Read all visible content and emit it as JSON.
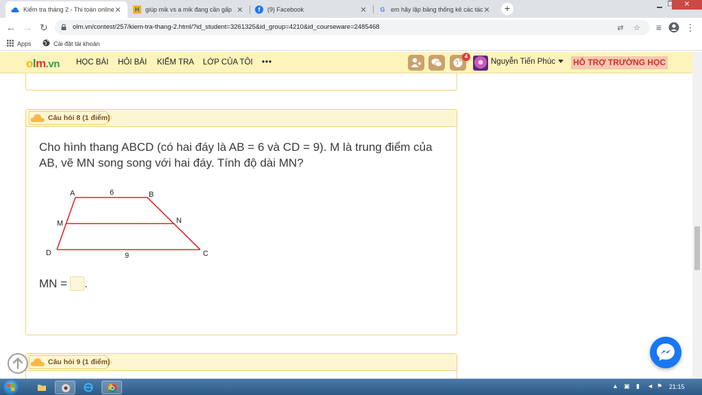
{
  "browser": {
    "tabs": [
      {
        "title": "Kiểm tra tháng 2 - Thi toán online",
        "icon": "cloud-icon"
      },
      {
        "title": "giúp mik vs a mik đang cần gấp",
        "icon": "hoc24-icon"
      },
      {
        "title": "(9) Facebook",
        "icon": "facebook-icon"
      },
      {
        "title": "em hãy lập bảng thống kê các tác",
        "icon": "google-icon"
      }
    ],
    "new_tab": "+",
    "url": "olm.vn/contest/257/kiem-tra-thang-2.html/?id_student=3261325&id_group=4210&id_courseware=2485468",
    "bookmarks": {
      "apps": "Apps",
      "account": "Cài đặt tài khoản"
    }
  },
  "site": {
    "logo": {
      "o": "o",
      "l": "l",
      "m": "m",
      "dv": ".vn"
    },
    "nav": {
      "hoc_bai": "HỌC BÀI",
      "hoi_bai": "HỎI BÀI",
      "kiem_tra": "KIỂM TRA",
      "lop_cua_toi": "LỚP CỦA TÔI",
      "more": "•••"
    },
    "notification_count": "4",
    "username": "Nguyễn Tiến Phúc",
    "support_label": "HỖ TRỢ TRƯỜNG HỌC"
  },
  "questions": {
    "q8": {
      "label": "Câu hỏi 8 (1 điểm)",
      "text": "Cho hình thang ABCD (có hai đáy là AB = 6 và CD = 9). M là trung điểm của AB, vẽ MN song song với hai đáy. Tính độ dài MN?",
      "figure": {
        "A": "A",
        "B": "B",
        "C": "C",
        "D": "D",
        "M": "M",
        "N": "N",
        "ab_length": "6",
        "cd_length": "9",
        "line_color": "#e0262a"
      },
      "answer_prefix": "MN =",
      "answer_suffix": ".",
      "answer_value": ""
    },
    "q9": {
      "label": "Câu hỏi 9 (1 điểm)"
    }
  },
  "taskbar": {
    "clock": "21:15"
  },
  "colors": {
    "nav_bg": "#fcf4ba",
    "card_border": "#f0d37a",
    "support_text": "#d32f2f",
    "messenger": "#1877f2"
  }
}
